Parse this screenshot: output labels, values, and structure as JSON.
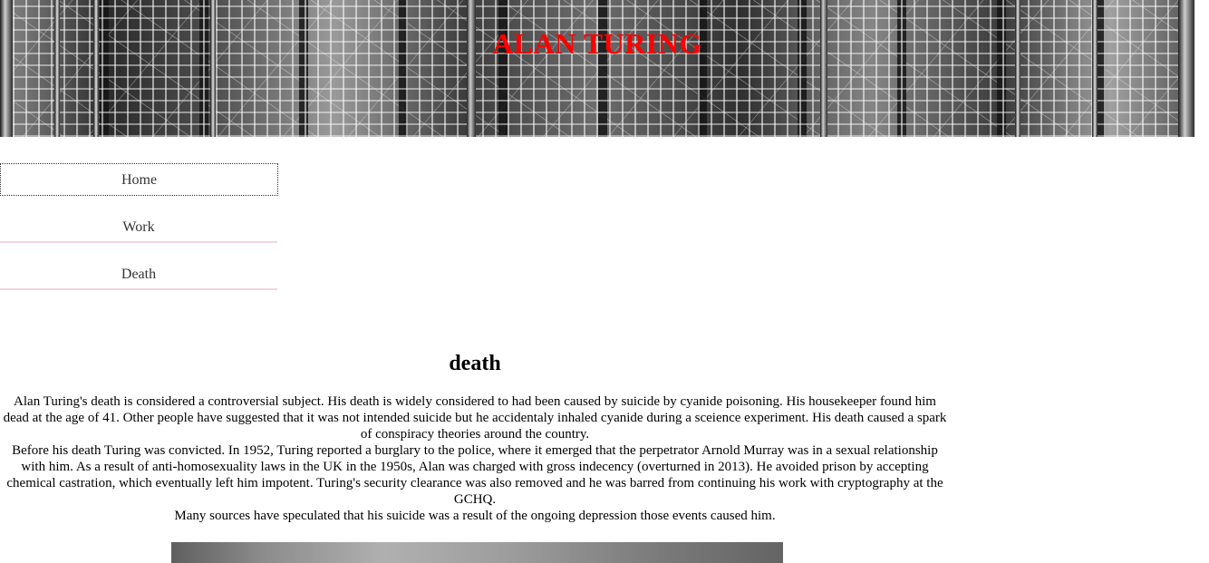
{
  "header": {
    "title": "ALAN TURING"
  },
  "nav": {
    "items": [
      {
        "label": "Home"
      },
      {
        "label": "Work"
      },
      {
        "label": "Death"
      }
    ]
  },
  "main": {
    "heading": "death",
    "paragraphs": [
      "Alan Turing's death is considered a controversial subject. His death is widely considered to had been caused by suicide by cyanide poisoning. His housekeeper found him dead at the age of 41. Other people have suggested that it was not intended suicide but he accidentaly inhaled cyanide during a sceience experiment. His death caused a spark of conspiracy theories around the country.",
      "Before his death Turing was convicted. In 1952, Turing reported a burglary to the police, where it emerged that the perpetrator Arnold Murray was in a sexual relationship with him. As a result of anti-homosexuality laws in the UK in the 1950s, Alan was charged with gross indecency (overturned in 2013). He avoided prison by accepting chemical castration, which eventually left him impotent. Turing's security clearance was also removed and he was barred from continuing his work with cryptography at the GCHQ.",
      "Many sources have speculated that his suicide was a result of the ongoing depression those events caused him."
    ]
  },
  "colors": {
    "title": "#ff0000",
    "nav_underline": "#f4d6e1",
    "nav_text": "#333333"
  }
}
